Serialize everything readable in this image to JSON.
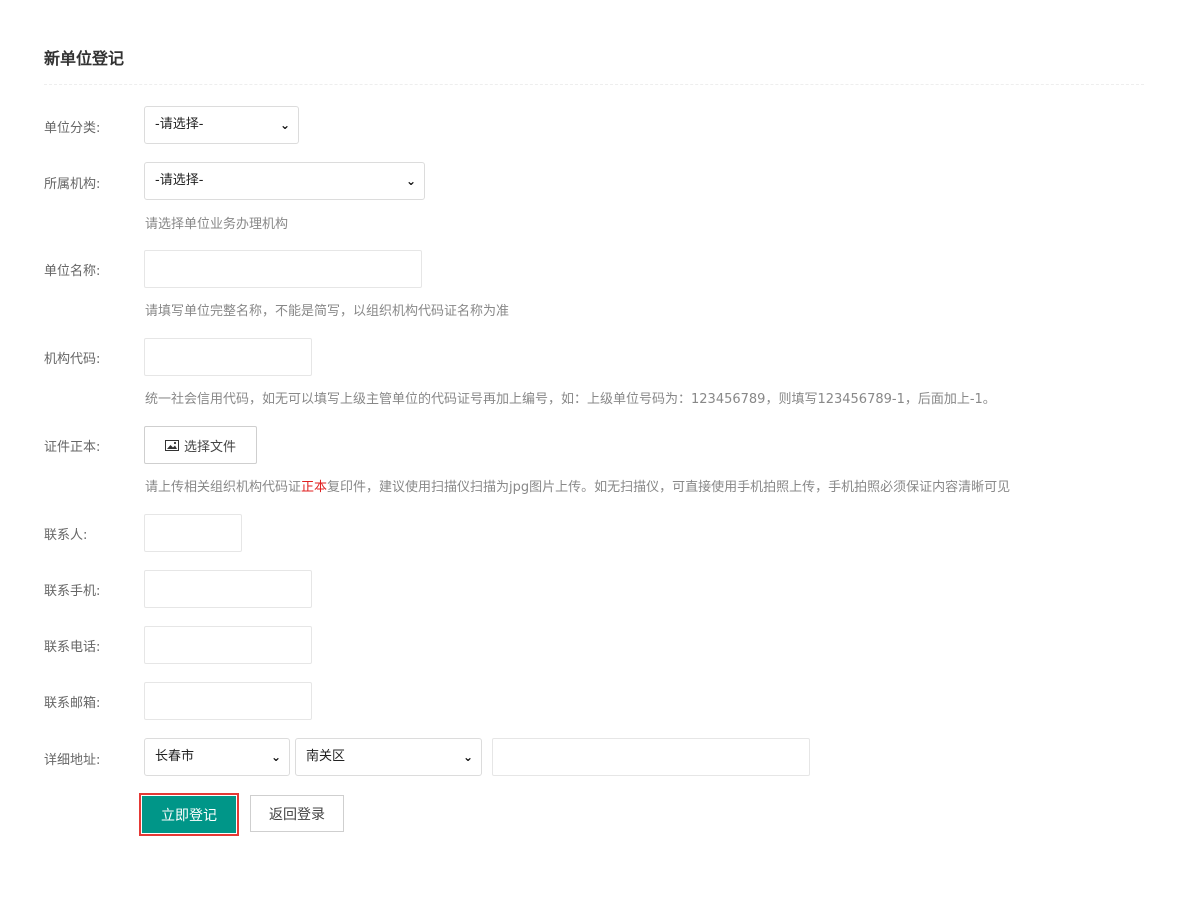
{
  "page": {
    "title": "新单位登记"
  },
  "fields": {
    "category": {
      "label": "单位分类:",
      "value": "-请选择-"
    },
    "org": {
      "label": "所属机构:",
      "value": "-请选择-",
      "help": "请选择单位业务办理机构"
    },
    "name": {
      "label": "单位名称:",
      "value": "",
      "help": "请填写单位完整名称，不能是简写，以组织机构代码证名称为准"
    },
    "code": {
      "label": "机构代码:",
      "value": "",
      "help": "统一社会信用代码，如无可以填写上级主管单位的代码证号再加上编号，如：上级单位号码为：123456789，则填写123456789-1，后面加上-1。"
    },
    "certificate": {
      "label": "证件正本:",
      "button": "选择文件",
      "help_before": "请上传相关组织机构代码证",
      "help_emphasis": "正本",
      "help_after": "复印件，建议使用扫描仪扫描为jpg图片上传。如无扫描仪，可直接使用手机拍照上传，手机拍照必须保证内容清晰可见"
    },
    "contact": {
      "label": "联系人:",
      "value": ""
    },
    "mobile": {
      "label": "联系手机:",
      "value": ""
    },
    "phone": {
      "label": "联系电话:",
      "value": ""
    },
    "email": {
      "label": "联系邮箱:",
      "value": ""
    },
    "address": {
      "label": "详细地址:",
      "city": "长春市",
      "district": "南关区",
      "detail": ""
    }
  },
  "actions": {
    "submit": "立即登记",
    "back": "返回登录"
  },
  "icons": {
    "select_arrow": "chevron-down-icon",
    "file": "image-icon"
  },
  "colors": {
    "primary": "#009688",
    "emphasis": "#e02020",
    "focus": "#e53935"
  }
}
